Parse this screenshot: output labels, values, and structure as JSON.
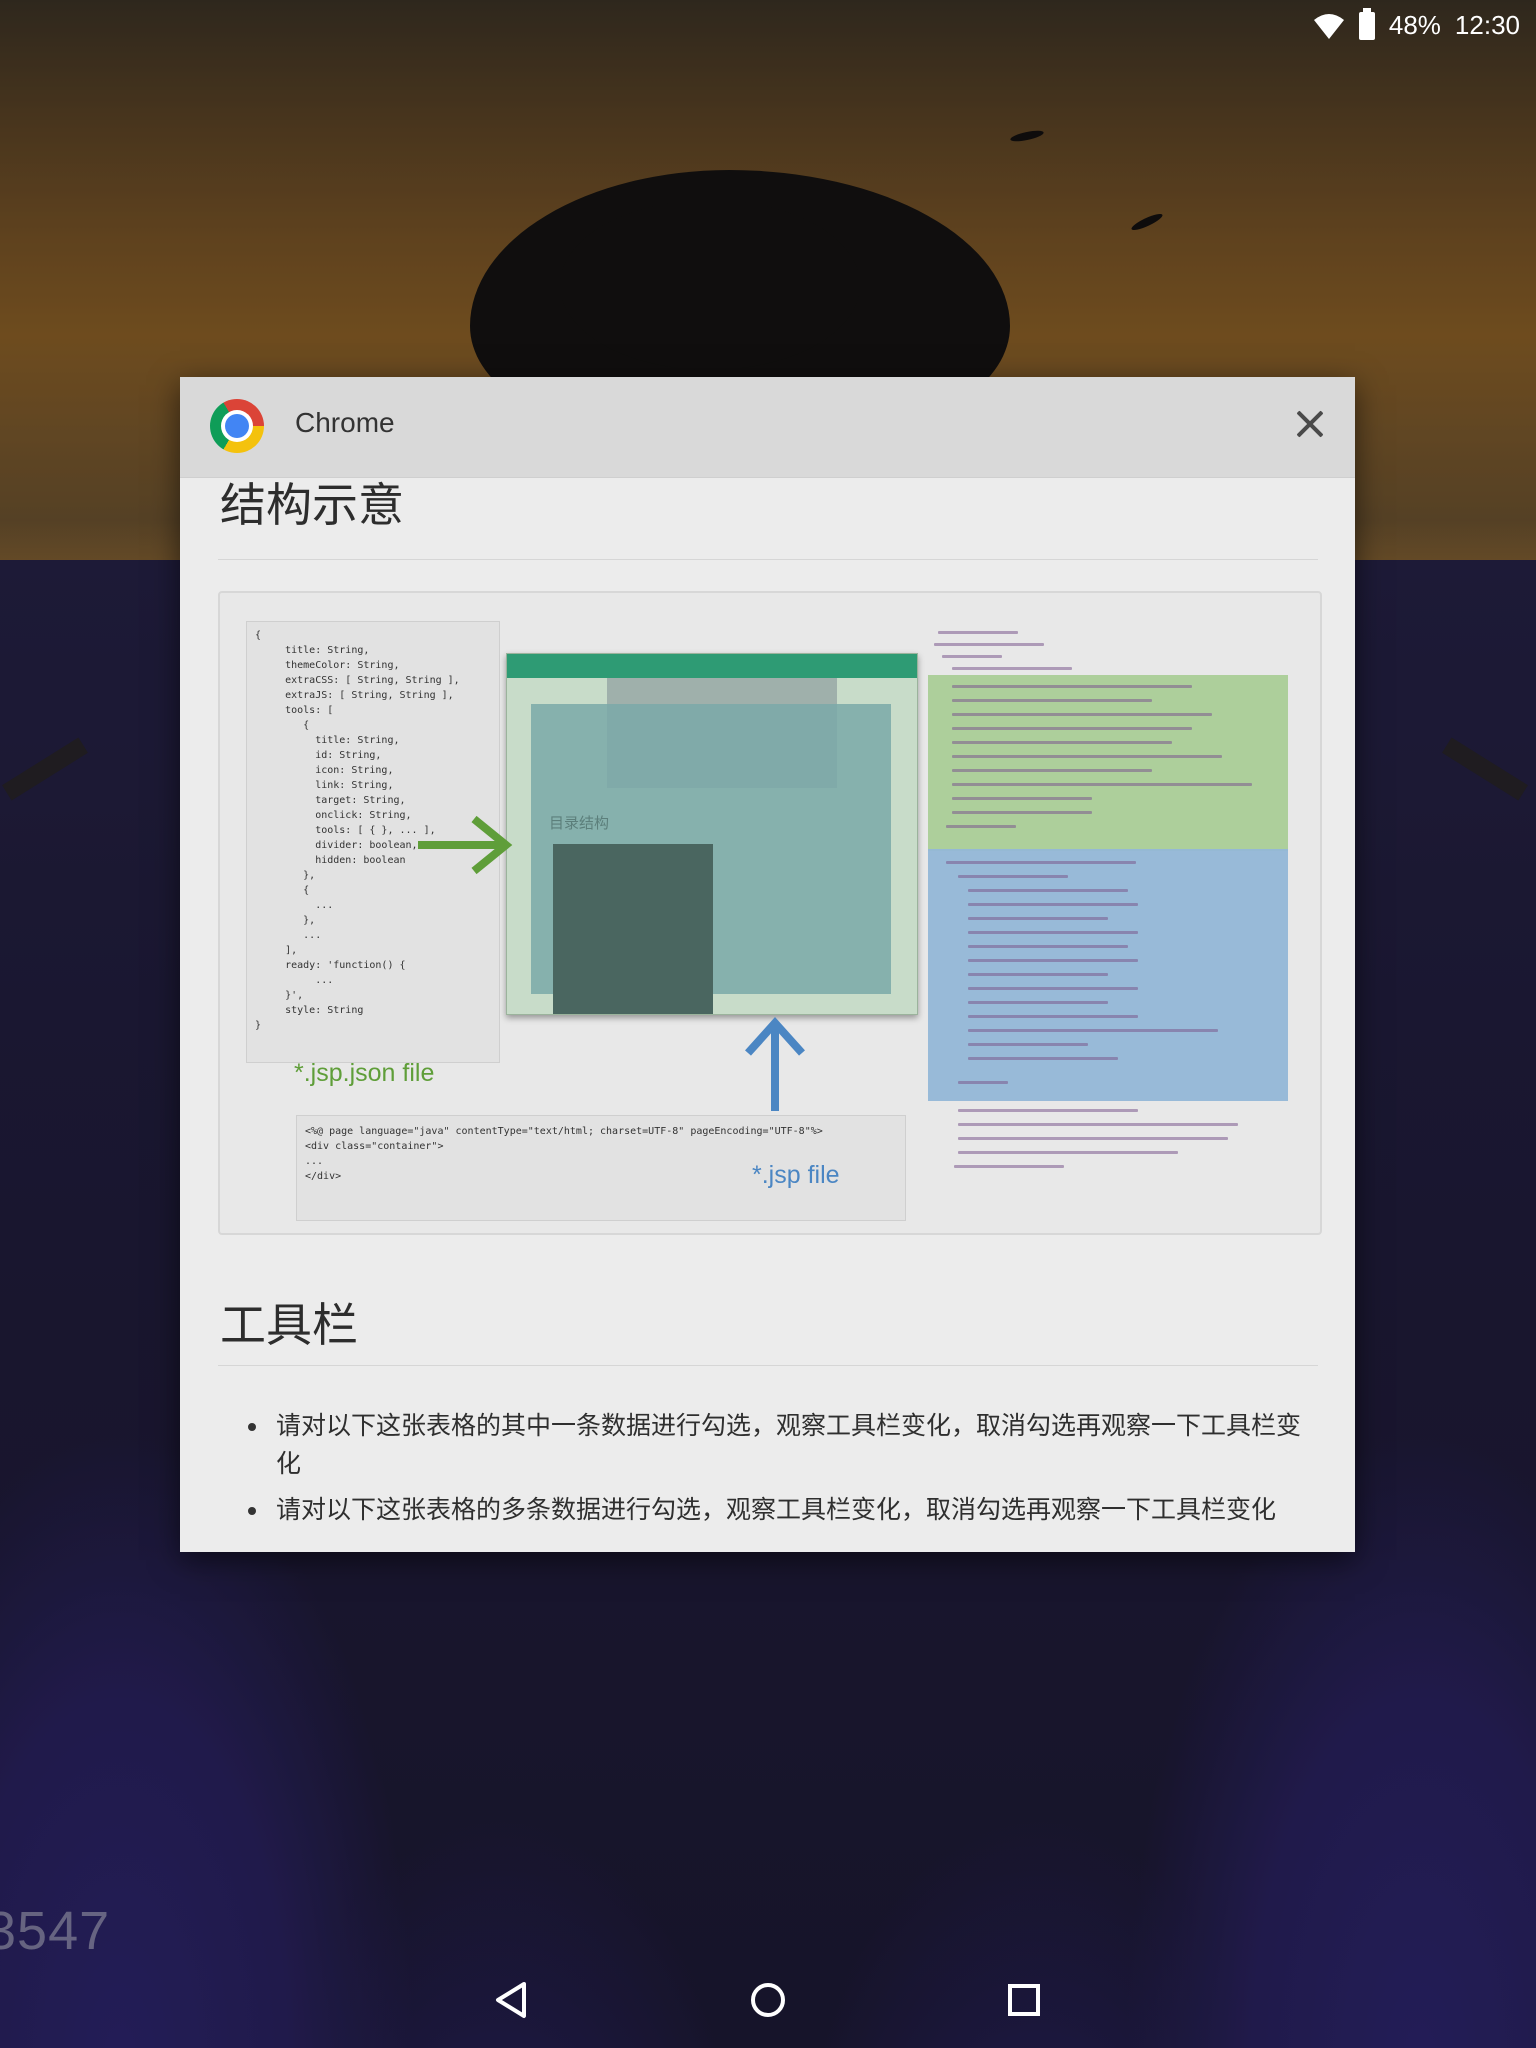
{
  "status_bar": {
    "battery": "48%",
    "time": "12:30"
  },
  "watermark": "3547",
  "app": {
    "title": "Chrome"
  },
  "content": {
    "section1_title": "结构示意",
    "figure": {
      "json_label": "*.jsp.json file",
      "jsp_label": "*.jsp file",
      "json_code": "{\n     title: String,\n     themeColor: String,\n     extraCSS: [ String, String ],\n     extraJS: [ String, String ],\n     tools: [\n        {\n          title: String,\n          id: String,\n          icon: String,\n          link: String,\n          target: String,\n          onclick: String,\n          tools: [ { }, ... ],\n          divider: boolean,\n          hidden: boolean\n        },\n        {\n          ...\n        },\n        ...\n     ],\n     ready: 'function() {\n          ...\n     }',\n     style: String\n}",
      "jsp_code": "<%@ page language=\"java\" contentType=\"text/html; charset=UTF-8\" pageEncoding=\"UTF-8\"%>\n<div class=\"container\">\n...\n</div>",
      "screenshot_heading": "目录结构"
    },
    "section2_title": "工具栏",
    "bullets": [
      "请对以下这张表格的其中一条数据进行勾选，观察工具栏变化，取消勾选再观察一下工具栏变化",
      "请对以下这张表格的多条数据进行勾选，观察工具栏变化，取消勾选再观察一下工具栏变化"
    ]
  },
  "icons": {
    "wifi": "wifi-icon",
    "battery": "battery-icon",
    "close": "close-icon",
    "back": "back-icon",
    "home": "home-icon",
    "recents": "recents-icon",
    "chrome": "chrome-logo-icon"
  }
}
